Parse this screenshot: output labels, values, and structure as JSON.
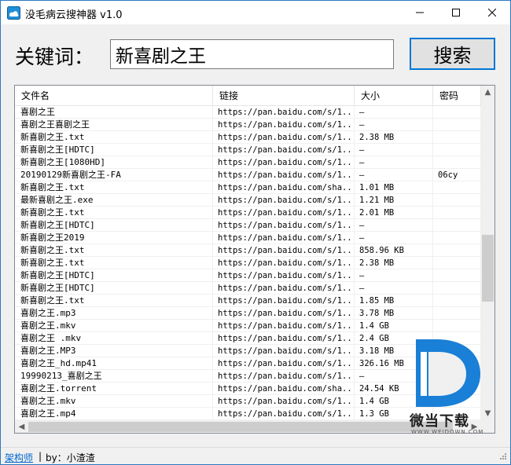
{
  "window": {
    "title": "没毛病云搜神器 v1.0",
    "controls": {
      "minimize": "—",
      "maximize": "☐",
      "close": "✕"
    }
  },
  "search": {
    "label": "关键词：",
    "value": "新喜剧之王",
    "button_label": "搜索"
  },
  "table": {
    "columns": [
      "文件名",
      "链接",
      "大小",
      "密码"
    ],
    "rows": [
      [
        "喜剧之王",
        "https://pan.baidu.com/s/1...",
        "—",
        ""
      ],
      [
        "喜剧之王喜剧之王",
        "https://pan.baidu.com/s/1...",
        "—",
        ""
      ],
      [
        "新喜剧之王.txt",
        "https://pan.baidu.com/s/1...",
        "2.38 MB",
        ""
      ],
      [
        "新喜剧之王[HDTC]",
        "https://pan.baidu.com/s/1...",
        "—",
        ""
      ],
      [
        "新喜剧之王[1080HD]",
        "https://pan.baidu.com/s/1...",
        "—",
        ""
      ],
      [
        "20190129新喜剧之王-FA",
        "https://pan.baidu.com/s/1...",
        "—",
        "06cy"
      ],
      [
        "新喜剧之王.txt",
        "https://pan.baidu.com/sha...",
        "1.01 MB",
        ""
      ],
      [
        "最新喜剧之王.exe",
        "https://pan.baidu.com/s/1...",
        "1.21 MB",
        ""
      ],
      [
        "新喜剧之王.txt",
        "https://pan.baidu.com/s/1...",
        "2.01 MB",
        ""
      ],
      [
        "新喜剧之王[HDTC]",
        "https://pan.baidu.com/s/1...",
        "—",
        ""
      ],
      [
        "新喜剧之王2019",
        "https://pan.baidu.com/s/1...",
        "—",
        ""
      ],
      [
        "新喜剧之王.txt",
        "https://pan.baidu.com/s/1...",
        "858.96 KB",
        ""
      ],
      [
        "新喜剧之王.txt",
        "https://pan.baidu.com/s/1...",
        "2.38 MB",
        ""
      ],
      [
        "新喜剧之王[HDTC]",
        "https://pan.baidu.com/s/1...",
        "—",
        ""
      ],
      [
        "新喜剧之王[HDTC]",
        "https://pan.baidu.com/s/1...",
        "—",
        ""
      ],
      [
        "新喜剧之王.txt",
        "https://pan.baidu.com/s/1...",
        "1.85 MB",
        ""
      ],
      [
        "喜剧之王.mp3",
        "https://pan.baidu.com/s/1...",
        "3.78 MB",
        ""
      ],
      [
        "喜剧之王.mkv",
        "https://pan.baidu.com/s/1...",
        "1.4 GB",
        ""
      ],
      [
        "喜剧之王 .mkv",
        "https://pan.baidu.com/s/1...",
        "2.4 GB",
        ""
      ],
      [
        "喜剧之王.MP3",
        "https://pan.baidu.com/s/1...",
        "3.18 MB",
        ""
      ],
      [
        "喜剧之王_hd.mp41",
        "https://pan.baidu.com/s/1...",
        "326.16 MB",
        ""
      ],
      [
        "19990213_喜剧之王",
        "https://pan.baidu.com/s/1...",
        "—",
        ""
      ],
      [
        "喜剧之王.torrent",
        "https://pan.baidu.com/sha...",
        "24.54 KB",
        ""
      ],
      [
        "喜剧之王.mkv",
        "https://pan.baidu.com/s/1...",
        "1.4 GB",
        ""
      ],
      [
        "喜剧之王.mp4",
        "https://pan.baidu.com/s/1...",
        "1.3 GB",
        ""
      ]
    ]
  },
  "statusbar": {
    "link": "架构师",
    "separator": "|",
    "by_text": "by：小渣渣"
  },
  "watermark": {
    "brand": "微当下载",
    "url": "WWW.WEIDOWN.COM"
  },
  "icons": {
    "app": "cloud-search-icon",
    "scroll_up": "▲",
    "scroll_down": "▼",
    "scroll_left": "◀",
    "scroll_right": "▶"
  },
  "colors": {
    "accent": "#0078d7",
    "link": "#0066cc",
    "watermark": "#1a7fd6"
  }
}
